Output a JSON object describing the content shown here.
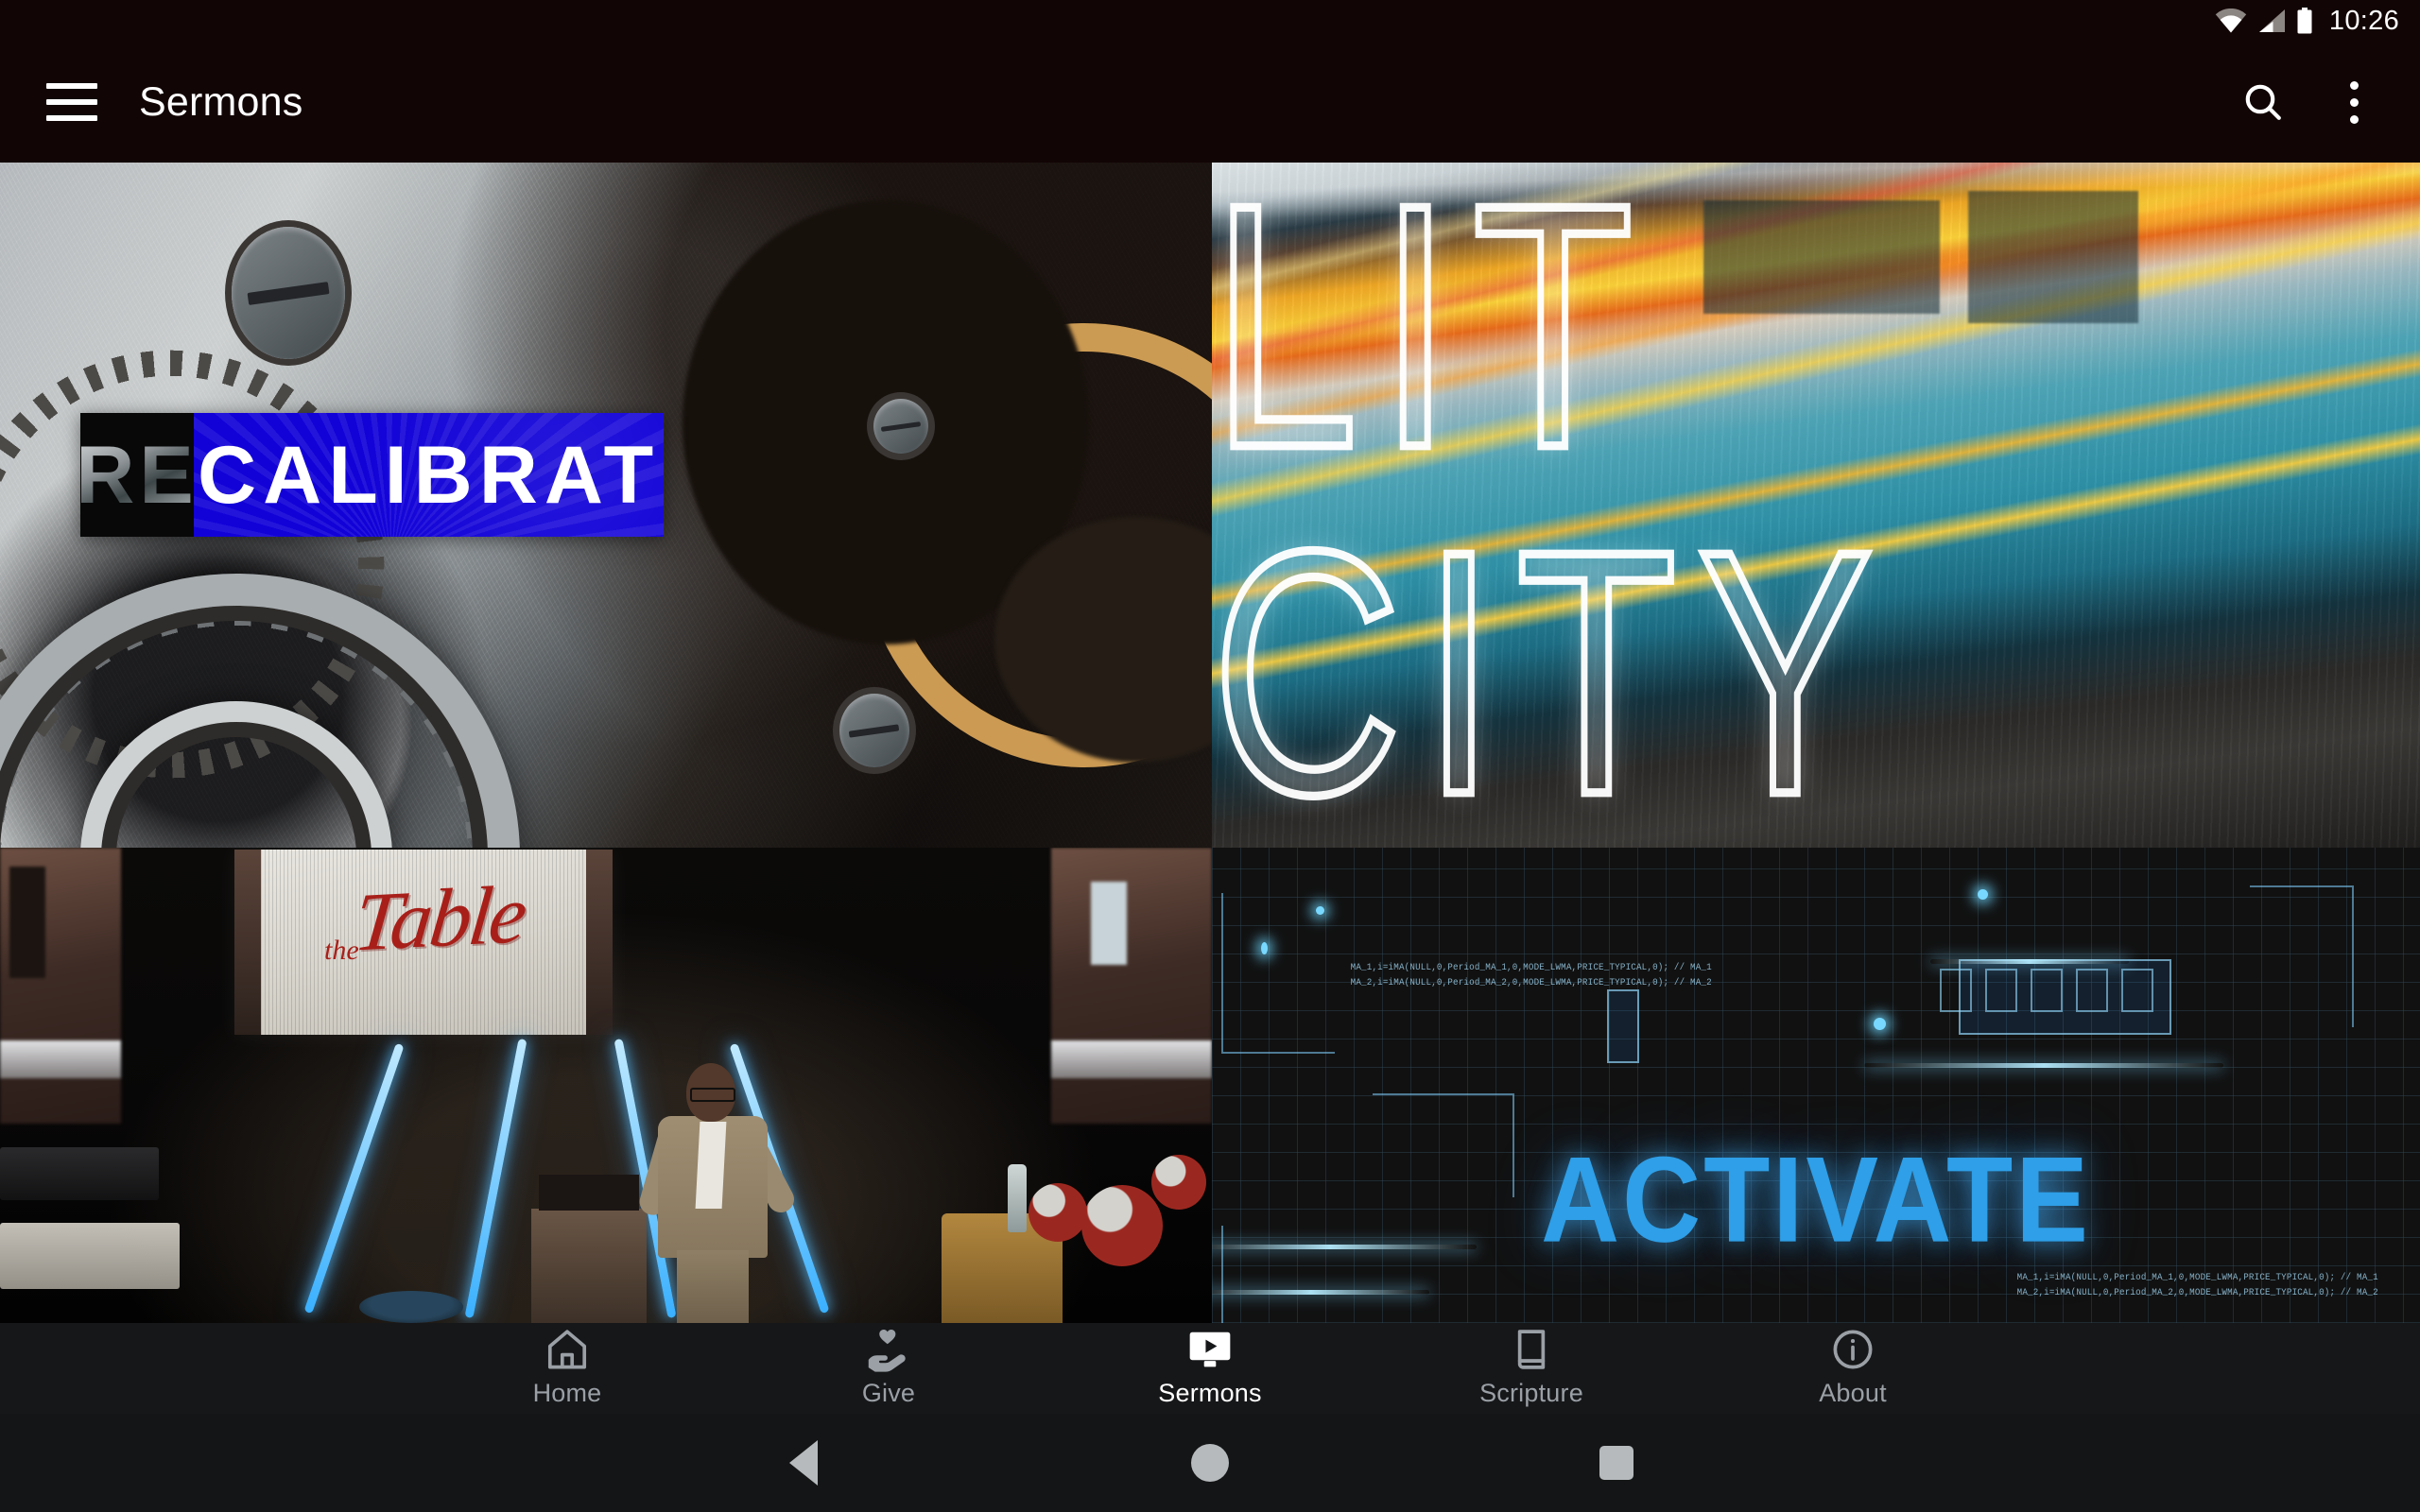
{
  "status_bar": {
    "time": "10:26",
    "icons": [
      "wifi-icon",
      "cellular-signal-icon",
      "battery-icon"
    ]
  },
  "app_bar": {
    "menu_icon": "hamburger-menu-icon",
    "title": "Sermons",
    "search_icon": "search-icon",
    "overflow_icon": "more-vertical-icon"
  },
  "sermons": [
    {
      "id": "recalibrate",
      "title_prefix": "RE",
      "title_rest": "CALIBRATE",
      "artwork": "gears-clockwork-photo",
      "accent": "#1202d8"
    },
    {
      "id": "lit-city",
      "title": "LIT CITY",
      "artwork": "motion-blur-street-photo",
      "accent": "#ffffff"
    },
    {
      "id": "the-table",
      "title_small": "the",
      "title_script": "Table",
      "artwork": "stage-preacher-photo",
      "accent": "#a81f19"
    },
    {
      "id": "activate",
      "title": "ACTIVATE",
      "artwork": "blue-circuit-tech-graphic",
      "accent": "#2e9fe8",
      "code_line_1": "MA_1,i=iMA(NULL,0,Period_MA_1,0,MODE_LWMA,PRICE_TYPICAL,0); // MA_1",
      "code_line_2": "MA_2,i=iMA(NULL,0,Period_MA_2,0,MODE_LWMA,PRICE_TYPICAL,0); // MA_2",
      "code_line_3": "MA_1,i=iMA(NULL,0,Period_MA_1,0,MODE_LWMA,PRICE_TYPICAL,0); // MA_1",
      "code_line_4": "MA_2,i=iMA(NULL,0,Period_MA_2,0,MODE_LWMA,PRICE_TYPICAL,0); // MA_2"
    }
  ],
  "tab_bar": {
    "active": "Sermons",
    "items": [
      {
        "label": "Home",
        "icon": "home-icon"
      },
      {
        "label": "Give",
        "icon": "hand-heart-icon"
      },
      {
        "label": "Sermons",
        "icon": "monitor-play-icon"
      },
      {
        "label": "Scripture",
        "icon": "book-icon"
      },
      {
        "label": "About",
        "icon": "info-circle-icon"
      }
    ]
  },
  "nav_bar": {
    "back": "back-triangle-icon",
    "home": "home-circle-icon",
    "recents": "recents-square-icon"
  }
}
